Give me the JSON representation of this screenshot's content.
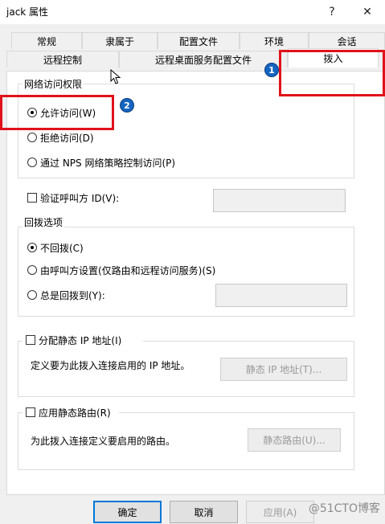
{
  "window": {
    "title": "jack 属性",
    "help_label": "?",
    "close_label": "✕"
  },
  "tabs_row1": [
    "常规",
    "隶属于",
    "配置文件",
    "环境",
    "会话"
  ],
  "tabs_row2": [
    "远程控制",
    "远程桌面服务配置文件",
    "拨入"
  ],
  "network_access": {
    "legend": "网络访问权限",
    "allow": "允许访问(W)",
    "deny": "拒绝访问(D)",
    "nps": "通过 NPS 网络策略控制访问(P)"
  },
  "verify_caller": {
    "label": "验证呼叫方 ID(V):",
    "value": ""
  },
  "callback": {
    "legend": "回拨选项",
    "no_callback": "不回拨(C)",
    "caller_set": "由呼叫方设置(仅路由和远程访问服务)(S)",
    "always": "总是回拨到(Y):",
    "always_value": ""
  },
  "static_ip": {
    "legend": "分配静态 IP 地址(I)",
    "description": "定义要为此拨入连接启用的 IP 地址。",
    "button": "静态 IP 地址(T)..."
  },
  "static_routes": {
    "legend": "应用静态路由(R)",
    "description": "为此拨入连接定义要启用的路由。",
    "button": "静态路由(U)..."
  },
  "buttons": {
    "ok": "确定",
    "cancel": "取消",
    "apply": "应用(A)"
  },
  "annotations": {
    "badge1": "1",
    "badge2": "2",
    "color": "#e0121b"
  },
  "watermark": "@51CTO博客"
}
